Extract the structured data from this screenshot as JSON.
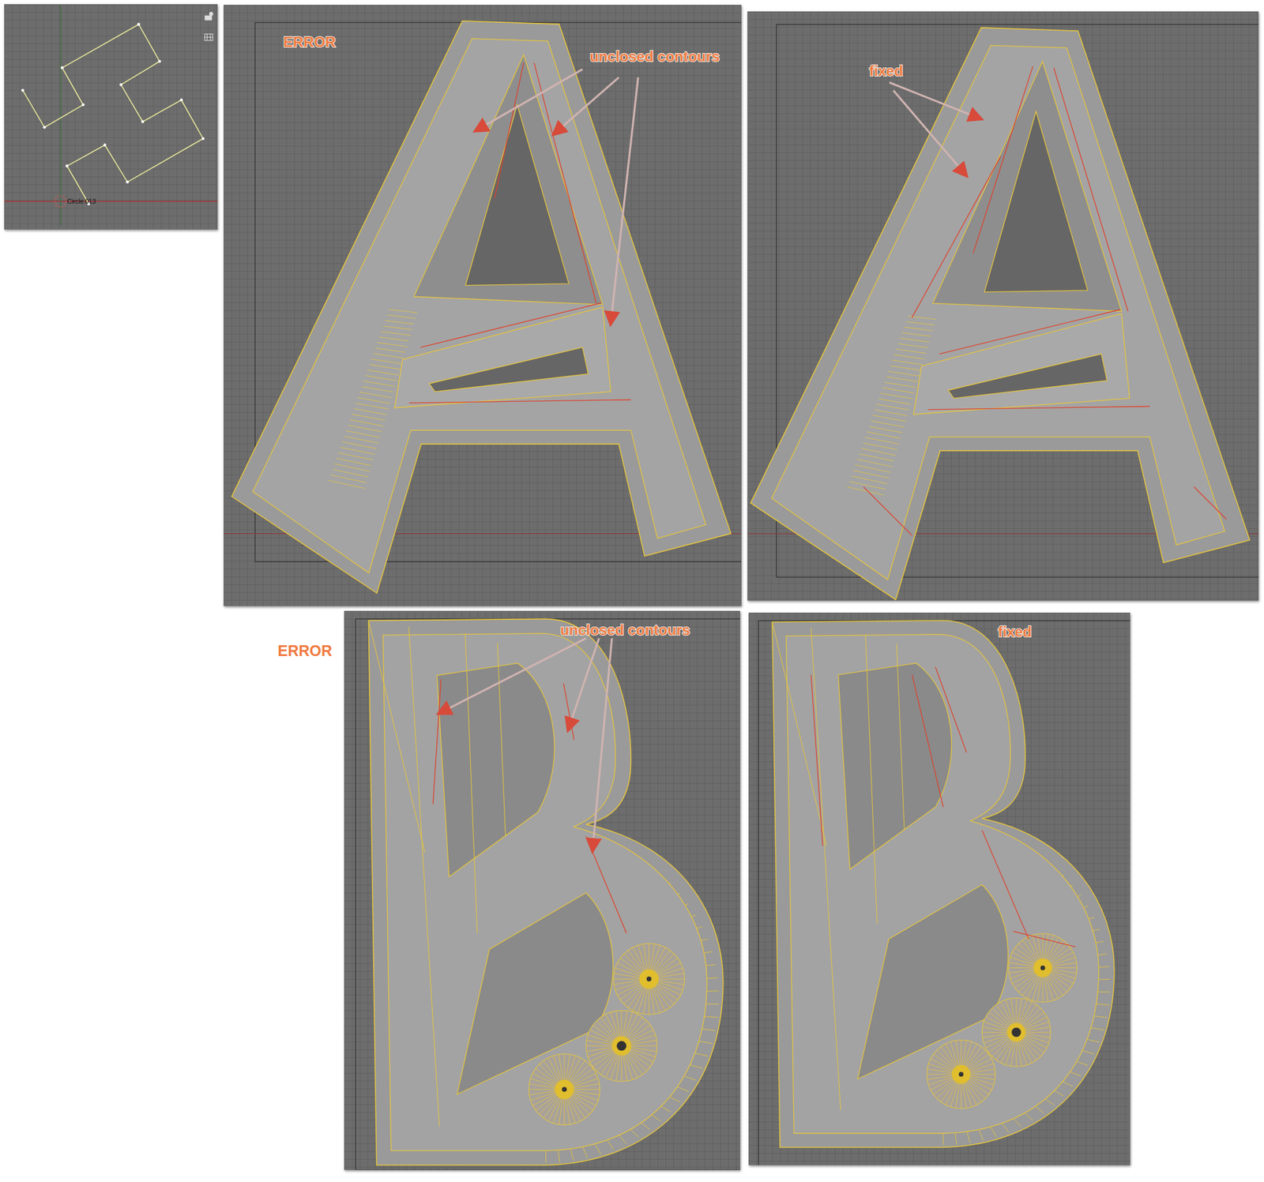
{
  "thumbnail": {
    "object_label": "Circle.013"
  },
  "panels": [
    {
      "kind": "a",
      "status": "error",
      "label": "ERROR",
      "callout": "unclosed contours"
    },
    {
      "kind": "a",
      "status": "fixed",
      "label": "",
      "callout": "fixed"
    },
    {
      "kind": "b",
      "status": "error",
      "label": "ERROR",
      "callout": "unclosed contours"
    },
    {
      "kind": "b",
      "status": "fixed",
      "label": "",
      "callout": "fixed"
    }
  ]
}
